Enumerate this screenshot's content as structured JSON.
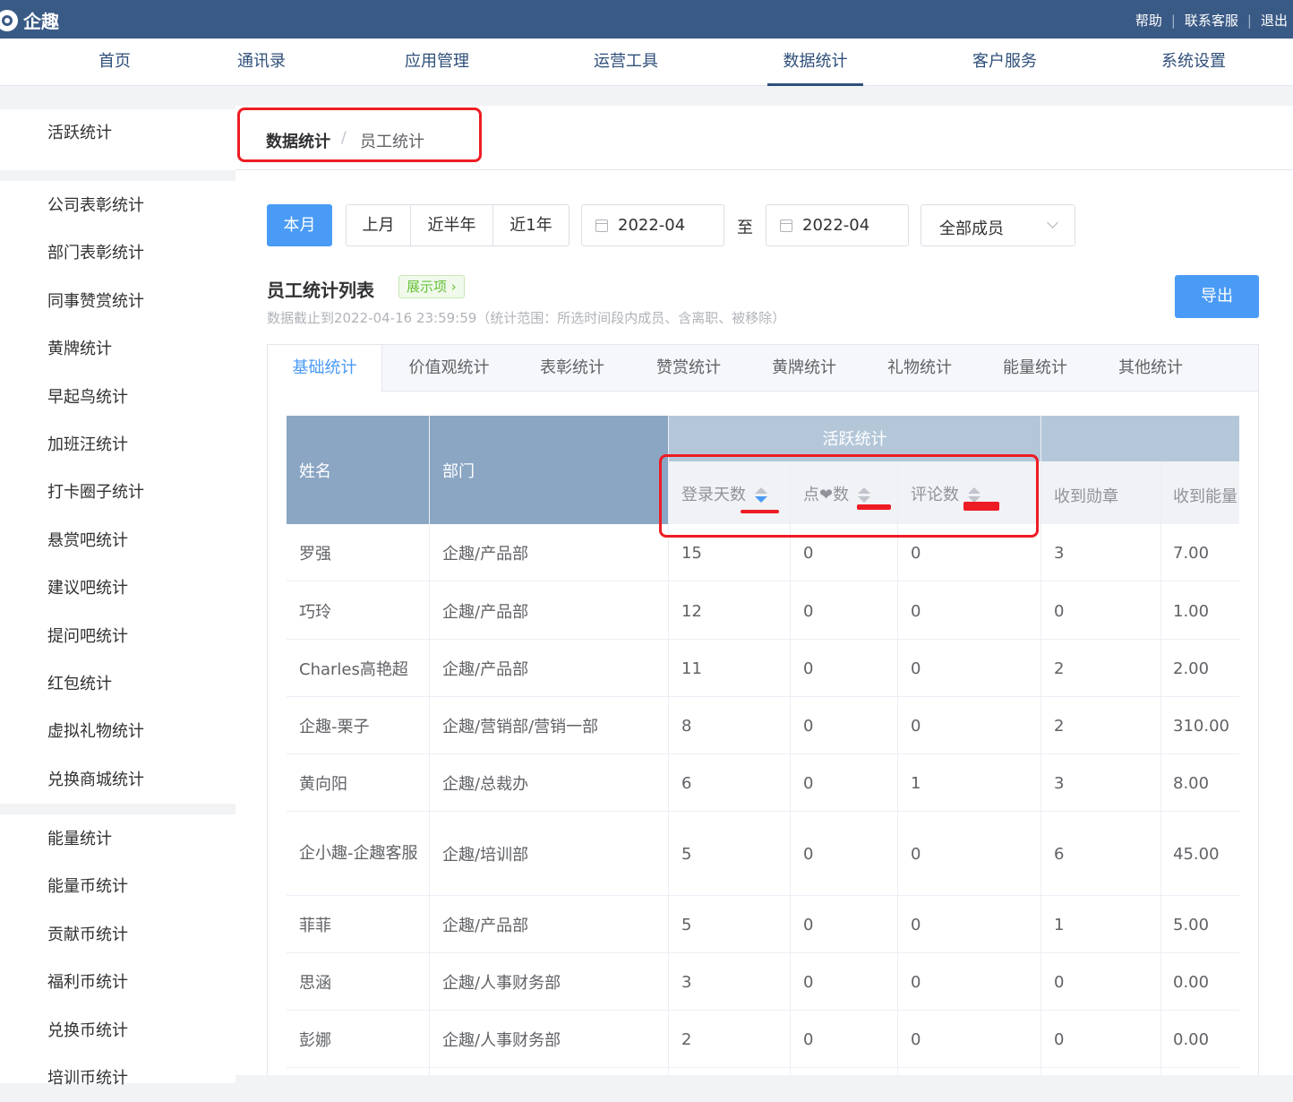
{
  "app": {
    "name": "企趣"
  },
  "toplinks": [
    "帮助",
    "联系客服",
    "退出"
  ],
  "nav": [
    "首页",
    "通讯录",
    "应用管理",
    "运营工具",
    "数据统计",
    "客户服务",
    "系统设置"
  ],
  "sidebar": {
    "group1": [
      "活跃统计"
    ],
    "group2": [
      "公司表彰统计",
      "部门表彰统计",
      "同事赞赏统计",
      "黄牌统计",
      "早起鸟统计",
      "加班汪统计",
      "打卡圈子统计",
      "悬赏吧统计",
      "建议吧统计",
      "提问吧统计",
      "红包统计",
      "虚拟礼物统计",
      "兑换商城统计"
    ],
    "group3": [
      "能量统计",
      "能量币统计",
      "贡献币统计",
      "福利币统计",
      "兑换币统计",
      "培训币统计"
    ]
  },
  "breadcrumb": {
    "parent": "数据统计",
    "sep": "/",
    "current": "员工统计"
  },
  "filters": {
    "this_month": "本月",
    "last_month": "上月",
    "half_year": "近半年",
    "one_year": "近1年",
    "start_date": "2022-04",
    "to": "至",
    "end_date": "2022-04",
    "member_select": "全部成员"
  },
  "list": {
    "title": "员工统计列表",
    "tag": "展示项",
    "note": "数据截止到2022-04-16 23:59:59（统计范围：所选时间段内成员、含离职、被移除）",
    "export": "导出"
  },
  "tabs": [
    "基础统计",
    "价值观统计",
    "表彰统计",
    "赞赏统计",
    "黄牌统计",
    "礼物统计",
    "能量统计",
    "其他统计"
  ],
  "table": {
    "headers": {
      "name": "姓名",
      "dept": "部门",
      "active_group": "活跃统计",
      "login_days": "登录天数",
      "likes": "点❤数",
      "comments": "评论数",
      "medals": "收到勋章",
      "energy": "收到能量"
    },
    "rows": [
      {
        "name": "罗强",
        "dept": "企趣/产品部",
        "login": "15",
        "likes": "0",
        "comments": "0",
        "medals": "3",
        "energy": "7.00"
      },
      {
        "name": "巧玲",
        "dept": "企趣/产品部",
        "login": "12",
        "likes": "0",
        "comments": "0",
        "medals": "0",
        "energy": "1.00"
      },
      {
        "name": "Charles高艳超",
        "dept": "企趣/产品部",
        "login": "11",
        "likes": "0",
        "comments": "0",
        "medals": "2",
        "energy": "2.00"
      },
      {
        "name": "企趣-栗子",
        "dept": "企趣/营销部/营销一部",
        "login": "8",
        "likes": "0",
        "comments": "0",
        "medals": "2",
        "energy": "310.00"
      },
      {
        "name": "黄向阳",
        "dept": "企趣/总裁办",
        "login": "6",
        "likes": "0",
        "comments": "1",
        "medals": "3",
        "energy": "8.00"
      },
      {
        "name": "企小趣-企趣客服",
        "dept": "企趣/培训部",
        "login": "5",
        "likes": "0",
        "comments": "0",
        "medals": "6",
        "energy": "45.00"
      },
      {
        "name": "菲菲",
        "dept": "企趣/产品部",
        "login": "5",
        "likes": "0",
        "comments": "0",
        "medals": "1",
        "energy": "5.00"
      },
      {
        "name": "思涵",
        "dept": "企趣/人事财务部",
        "login": "3",
        "likes": "0",
        "comments": "0",
        "medals": "0",
        "energy": "0.00"
      },
      {
        "name": "彭娜",
        "dept": "企趣/人事财务部",
        "login": "2",
        "likes": "0",
        "comments": "0",
        "medals": "0",
        "energy": "0.00"
      }
    ]
  }
}
